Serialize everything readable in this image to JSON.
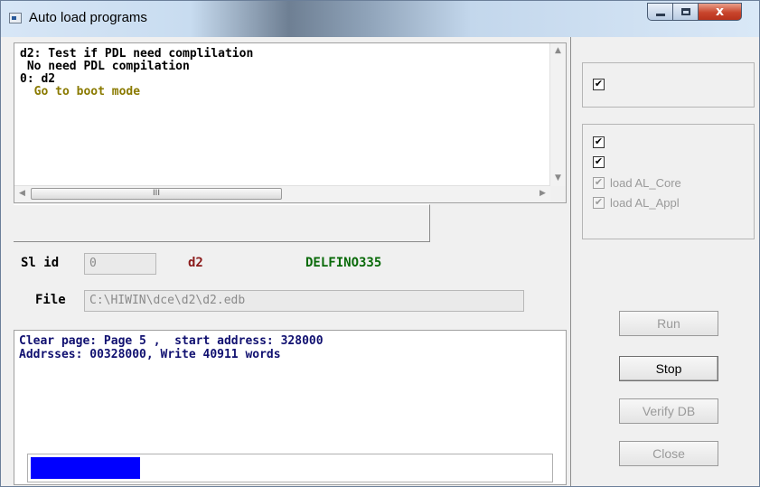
{
  "window": {
    "title": "Auto load programs",
    "close_glyph": "x"
  },
  "top_log": {
    "lines": [
      {
        "text": "d2: Test if PDL need complilation",
        "color": "#000000"
      },
      {
        "text": " No need PDL compilation",
        "color": "#000000"
      },
      {
        "text": "0: d2",
        "color": "#000000"
      },
      {
        "text": "  Go to boot mode",
        "color": "#8a7a00"
      }
    ],
    "hscroll_thumb": "III"
  },
  "info": {
    "slave_label": "Sl id",
    "slave_id": "0",
    "device_name": "d2",
    "chip": "DELFINO335",
    "file_label": "File",
    "file_path": "C:\\HIWIN\\dce\\d2\\d2.edb"
  },
  "bottom_log": {
    "lines": [
      "Clear page: Page 5 ,  start address: 328000",
      "Addrsses: 00328000, Write 40911 words"
    ],
    "progress_fraction": 0.21
  },
  "options": {
    "group1": [
      {
        "checked": true,
        "enabled": true,
        "label": ""
      }
    ],
    "group2": [
      {
        "checked": true,
        "enabled": true,
        "label": ""
      },
      {
        "checked": true,
        "enabled": true,
        "label": ""
      },
      {
        "checked": true,
        "enabled": false,
        "label": "load AL_Core"
      },
      {
        "checked": true,
        "enabled": false,
        "label": "load AL_Appl"
      }
    ]
  },
  "buttons": {
    "run": "Run",
    "stop": "Stop",
    "verify": "Verify DB",
    "close": "Close"
  },
  "colors": {
    "progress": "#0000ff",
    "device_name": "#8b1a1a",
    "chip": "#0a6a0a"
  }
}
